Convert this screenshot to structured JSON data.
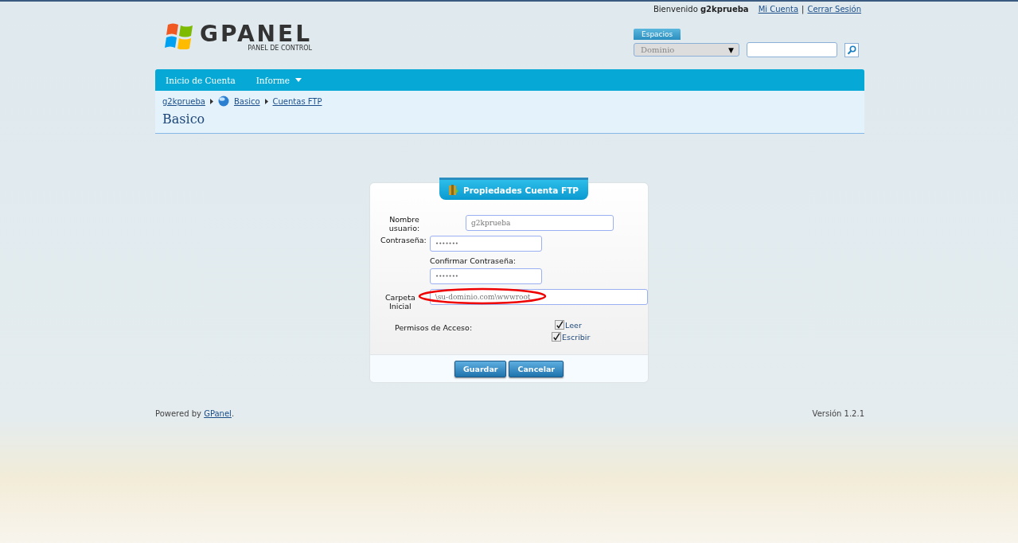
{
  "top_bar": {
    "welcome": "Bienvenido",
    "user": "g2kprueba",
    "links": [
      "Mi Cuenta",
      "Cerrar Sesión"
    ],
    "separator": "|"
  },
  "logo": {
    "name": "GPANEL",
    "subtitle": "PANEL DE CONTROL"
  },
  "search": {
    "tab": "Espacios",
    "dropdown": "Dominio",
    "dropdown_caret": "▼"
  },
  "nav": [
    {
      "label": "Inicio de Cuenta",
      "has_menu": false
    },
    {
      "label": "Informe",
      "has_menu": true
    }
  ],
  "breadcrumb": [
    "g2kprueba",
    "Basico",
    "Cuentas FTP"
  ],
  "page_title": "Basico",
  "form": {
    "title": "Propiedades Cuenta FTP",
    "username": {
      "label": "Nombre usuario:",
      "placeholder": "g2kprueba"
    },
    "password": {
      "label": "Contraseña:",
      "value": "•••••••"
    },
    "confirm": {
      "label": "Confirmar Contraseña:",
      "value": "•••••••"
    },
    "folder": {
      "label": "Carpeta Inicial",
      "placeholder": "\\su-dominio.com\\wwwroot",
      "annotated": true
    },
    "permissions": {
      "label": "Permisos de Acceso:",
      "options": [
        {
          "label": "Leer",
          "checked": true
        },
        {
          "label": "Escribir",
          "checked": true
        }
      ]
    },
    "buttons": [
      "Guardar",
      "Cancelar"
    ]
  },
  "footer": {
    "powered": "Powered by",
    "link": "GPanel",
    "dot": ".",
    "version": "Versión 1.2.1"
  }
}
